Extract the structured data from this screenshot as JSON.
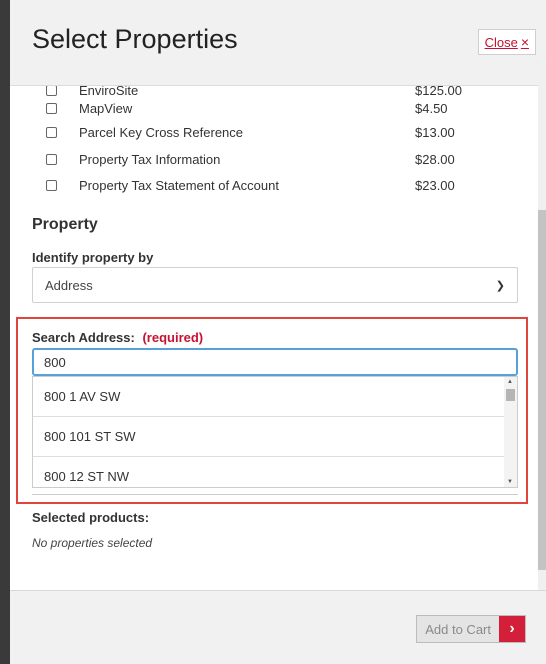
{
  "header": {
    "title": "Select Properties",
    "close_label": "Close",
    "close_icon": "×"
  },
  "products": [
    {
      "name": "EnviroSite",
      "price": "$125.00"
    },
    {
      "name": "MapView",
      "price": "$4.50"
    },
    {
      "name": "Parcel Key Cross Reference",
      "price": "$13.00"
    },
    {
      "name": "Property Tax Information",
      "price": "$28.00"
    },
    {
      "name": "Property Tax Statement of Account",
      "price": "$23.00"
    }
  ],
  "property": {
    "section_title": "Property",
    "identify_label": "Identify property by",
    "identify_value": "Address",
    "search_label": "Search Address:",
    "required_label": "(required)",
    "search_value": "800",
    "suggestions": [
      "800 1 AV SW",
      "800 101 ST SW",
      "800 12 ST NW"
    ]
  },
  "selected": {
    "label": "Selected products:",
    "empty_text": "No properties selected"
  },
  "footer": {
    "add_to_cart_label": "Add to Cart",
    "add_to_cart_icon": "›"
  },
  "colors": {
    "accent": "#d31f3a",
    "required": "#c41230",
    "highlight_border": "#e0453c",
    "focus_border": "#5aa0d8"
  }
}
